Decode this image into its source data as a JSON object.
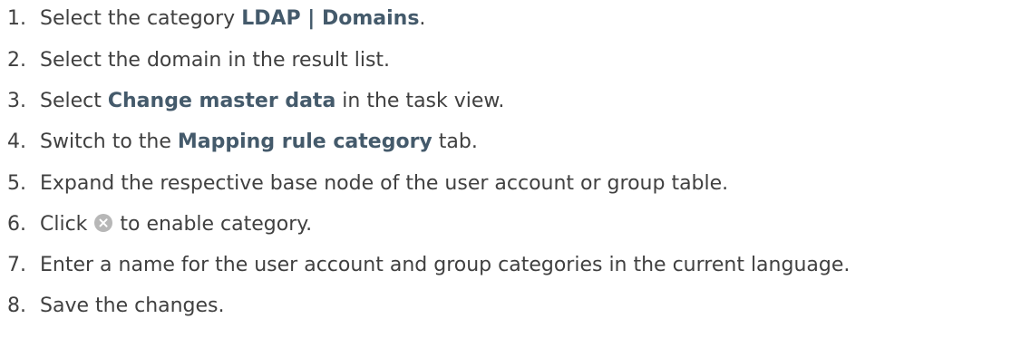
{
  "steps": [
    {
      "num": "1.",
      "text1": "Select the category ",
      "bold": "LDAP | Domains",
      "text2": "."
    },
    {
      "num": "2.",
      "text": "Select the domain in the result list."
    },
    {
      "num": "3.",
      "text1": "Select ",
      "bold": "Change master data",
      "text2": " in the task view."
    },
    {
      "num": "4.",
      "text1": "Switch to the ",
      "bold": "Mapping rule category",
      "text2": " tab."
    },
    {
      "num": "5.",
      "text": "Expand the respective base node of the user account or group table."
    },
    {
      "num": "6.",
      "text1": "Click ",
      "icon": "gray-circle-x-icon",
      "text2": " to enable category."
    },
    {
      "num": "7.",
      "text": "Enter a name for the user account and group categories in the current language."
    },
    {
      "num": "8.",
      "text": "Save the changes."
    }
  ]
}
